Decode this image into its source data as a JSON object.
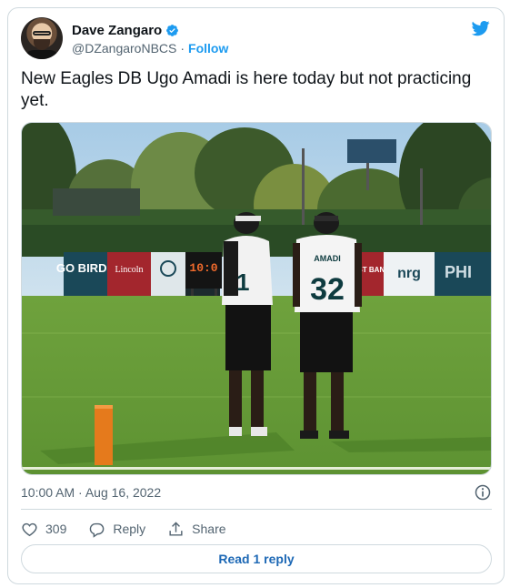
{
  "author": {
    "display_name": "Dave Zangaro",
    "handle": "@DZangaroNBCS",
    "separator": "·",
    "follow_label": "Follow"
  },
  "tweet": {
    "text": "New Eagles DB Ugo Amadi is here today but not practicing yet.",
    "timestamp": "10:00 AM · Aug 16, 2022"
  },
  "media": {
    "scoreboard_time": "10:0",
    "banners": [
      "GO BIRDS",
      "Lincoln",
      "TRUST BANK",
      "nrg",
      "PHI"
    ],
    "jersey_name": "AMADI",
    "jersey_number": "32",
    "other_jersey_number": "1"
  },
  "actions": {
    "likes_count": "309",
    "reply_label": "Reply",
    "share_label": "Share"
  },
  "read_reply_label": "Read 1 reply",
  "colors": {
    "accent": "#1d9bf0",
    "link": "#1d68b5",
    "border": "#cfd9de",
    "secondary_text": "#536471"
  }
}
